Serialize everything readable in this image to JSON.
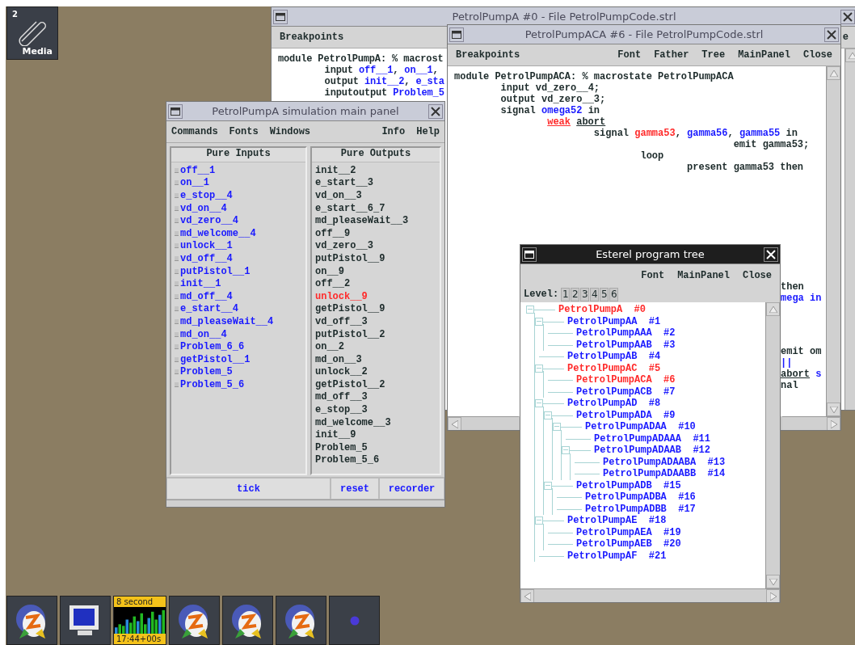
{
  "desktop": {
    "launcher": {
      "count": "2",
      "label": "Media"
    }
  },
  "code_window_back": {
    "title": "PetrolPumpA  #0  -  File PetrolPumpCode.strl",
    "focused": false,
    "menu": [
      "Breakpoints"
    ],
    "menu_right_fragment": "e",
    "lines": [
      {
        "segments": [
          {
            "text": "module PetrolPumpA: % macrost"
          }
        ]
      },
      {
        "segments": [
          {
            "text": "input "
          },
          {
            "text": "off__1",
            "color": "#1a1aff"
          },
          {
            "text": ", "
          },
          {
            "text": "on__1",
            "color": "#1a1aff"
          },
          {
            "text": ","
          }
        ]
      },
      {
        "segments": [
          {
            "text": "output "
          },
          {
            "text": "init__2",
            "color": "#1a1aff"
          },
          {
            "text": ", "
          },
          {
            "text": "e_sta",
            "color": "#1a1aff"
          }
        ]
      },
      {
        "segments": [
          {
            "text": "inputoutput "
          },
          {
            "text": "Problem_5",
            "color": "#1a1aff"
          }
        ]
      }
    ]
  },
  "simulation_panel": {
    "title": "PetrolPumpA simulation main panel",
    "focused": false,
    "menu_left": [
      "Commands",
      "Fonts",
      "Windows"
    ],
    "menu_right": [
      "Info",
      "Help"
    ],
    "inputs_title": "Pure Inputs",
    "inputs": [
      "off__1",
      "on__1",
      "e_stop__4",
      "vd_on__4",
      "vd_zero__4",
      "md_welcome__4",
      "unlock__1",
      "vd_off__4",
      "putPistol__1",
      "init__1",
      "md_off__4",
      "e_start__4",
      "md_pleaseWait__4",
      "md_on__4",
      "Problem_6_6",
      "getPistol__1",
      "Problem_5",
      "Problem_5_6"
    ],
    "outputs_title": "Pure Outputs",
    "outputs": [
      {
        "label": "init__2",
        "active": false
      },
      {
        "label": "e_start__3",
        "active": false
      },
      {
        "label": "vd_on__3",
        "active": false
      },
      {
        "label": "e_start__6_7",
        "active": false
      },
      {
        "label": "md_pleaseWait__3",
        "active": false
      },
      {
        "label": "off__9",
        "active": false
      },
      {
        "label": "vd_zero__3",
        "active": false
      },
      {
        "label": "putPistol__9",
        "active": false
      },
      {
        "label": "on__9",
        "active": false
      },
      {
        "label": "off__2",
        "active": false
      },
      {
        "label": "unlock__9",
        "active": true
      },
      {
        "label": "getPistol__9",
        "active": false
      },
      {
        "label": "vd_off__3",
        "active": false
      },
      {
        "label": "putPistol__2",
        "active": false
      },
      {
        "label": "on__2",
        "active": false
      },
      {
        "label": "md_on__3",
        "active": false
      },
      {
        "label": "unlock__2",
        "active": false
      },
      {
        "label": "getPistol__2",
        "active": false
      },
      {
        "label": "md_off__3",
        "active": false
      },
      {
        "label": "e_stop__3",
        "active": false
      },
      {
        "label": "md_welcome__3",
        "active": false
      },
      {
        "label": "init__9",
        "active": false
      },
      {
        "label": "Problem_5",
        "active": false
      },
      {
        "label": "Problem_5_6",
        "active": false
      }
    ],
    "buttons": [
      "tick",
      "reset",
      "recorder"
    ]
  },
  "code_window_front": {
    "title": "PetrolPumpACA  #6  -  File PetrolPumpCode.strl",
    "focused": false,
    "menu_left": [
      "Breakpoints"
    ],
    "menu_right": [
      "Font",
      "Father",
      "Tree",
      "MainPanel",
      "Close"
    ],
    "lines": [
      {
        "segments": [
          {
            "text": "module PetrolPumpACA: % macrostate PetrolPumpACA"
          }
        ]
      },
      {
        "segments": [
          {
            "text": "input vd_zero__4;"
          }
        ]
      },
      {
        "segments": [
          {
            "text": "output vd_zero__3;"
          }
        ]
      },
      {
        "segments": [
          {
            "text": "signal "
          },
          {
            "text": "omega52",
            "color": "#1a1aff"
          },
          {
            "text": " in"
          }
        ]
      },
      {
        "segments": [
          {
            "text": "weak",
            "color": "#ff2a2a",
            "underline": true
          },
          {
            "text": "abort",
            "underline": true
          }
        ]
      },
      {
        "segments": [
          {
            "text": "signal "
          },
          {
            "text": "gamma53",
            "color": "#ff2a2a"
          },
          {
            "text": ", "
          },
          {
            "text": "gamma56",
            "color": "#1a1aff"
          },
          {
            "text": ", "
          },
          {
            "text": "gamma55",
            "color": "#1a1aff"
          },
          {
            "text": " in"
          }
        ]
      },
      {
        "segments": [
          {
            "text": "emit gamma53;"
          }
        ]
      },
      {
        "segments": [
          {
            "text": "loop"
          }
        ]
      },
      {
        "segments": [
          {
            "text": "present gamma53 then"
          }
        ]
      }
    ],
    "fragment_groups": [
      [
        {
          "segments": [
            {
              "text": "then"
            }
          ]
        },
        {
          "segments": [
            {
              "text": "mega in",
              "color": "#1a1aff"
            }
          ]
        }
      ],
      [
        {
          "segments": [
            {
              "text": "emit om"
            }
          ]
        },
        {
          "segments": [
            {
              "text": "||",
              "color": "#1a1aff"
            }
          ]
        },
        {
          "segments": [
            {
              "text": "abort",
              "underline": true
            },
            {
              "text": " s",
              "color": "#1a1aff"
            }
          ]
        },
        {
          "segments": [
            {
              "text": "nal"
            }
          ]
        }
      ]
    ]
  },
  "tree_window": {
    "title": "Esterel program tree",
    "focused": true,
    "menu": [
      "Font",
      "MainPanel",
      "Close"
    ],
    "level_label": "Level:",
    "levels": [
      "1",
      "2",
      "3",
      "4",
      "5",
      "6"
    ],
    "tree": [
      {
        "label": "PetrolPumpA  #0",
        "active": true,
        "children": [
          {
            "label": "PetrolPumpAA  #1",
            "active": false,
            "children": [
              {
                "label": "PetrolPumpAAA  #2",
                "active": false
              },
              {
                "label": "PetrolPumpAAB  #3",
                "active": false
              }
            ]
          },
          {
            "label": "PetrolPumpAB  #4",
            "active": false
          },
          {
            "label": "PetrolPumpAC  #5",
            "active": true,
            "children": [
              {
                "label": "PetrolPumpACA  #6",
                "active": true
              },
              {
                "label": "PetrolPumpACB  #7",
                "active": false
              }
            ]
          },
          {
            "label": "PetrolPumpAD  #8",
            "active": false,
            "children": [
              {
                "label": "PetrolPumpADA  #9",
                "active": false,
                "children": [
                  {
                    "label": "PetrolPumpADAA  #10",
                    "active": false,
                    "children": [
                      {
                        "label": "PetrolPumpADAAA  #11",
                        "active": false
                      },
                      {
                        "label": "PetrolPumpADAAB  #12",
                        "active": false,
                        "children": [
                          {
                            "label": "PetrolPumpADAABA  #13",
                            "active": false
                          },
                          {
                            "label": "PetrolPumpADAABB  #14",
                            "active": false
                          }
                        ]
                      }
                    ]
                  }
                ]
              },
              {
                "label": "PetrolPumpADB  #15",
                "active": false,
                "children": [
                  {
                    "label": "PetrolPumpADBA  #16",
                    "active": false
                  },
                  {
                    "label": "PetrolPumpADBB  #17",
                    "active": false
                  }
                ]
              }
            ]
          },
          {
            "label": "PetrolPumpAE  #18",
            "active": false,
            "children": [
              {
                "label": "PetrolPumpAEA  #19",
                "active": false
              },
              {
                "label": "PetrolPumpAEB  #20",
                "active": false
              }
            ]
          },
          {
            "label": "PetrolPumpAF  #21",
            "active": false
          }
        ]
      }
    ]
  },
  "taskbar": {
    "items": [
      {
        "kind": "app"
      },
      {
        "kind": "monitor"
      },
      {
        "kind": "load",
        "top": "8 second",
        "bottom": "17:44+00s"
      },
      {
        "kind": "app"
      },
      {
        "kind": "app"
      },
      {
        "kind": "app"
      },
      {
        "kind": "globe"
      }
    ]
  }
}
